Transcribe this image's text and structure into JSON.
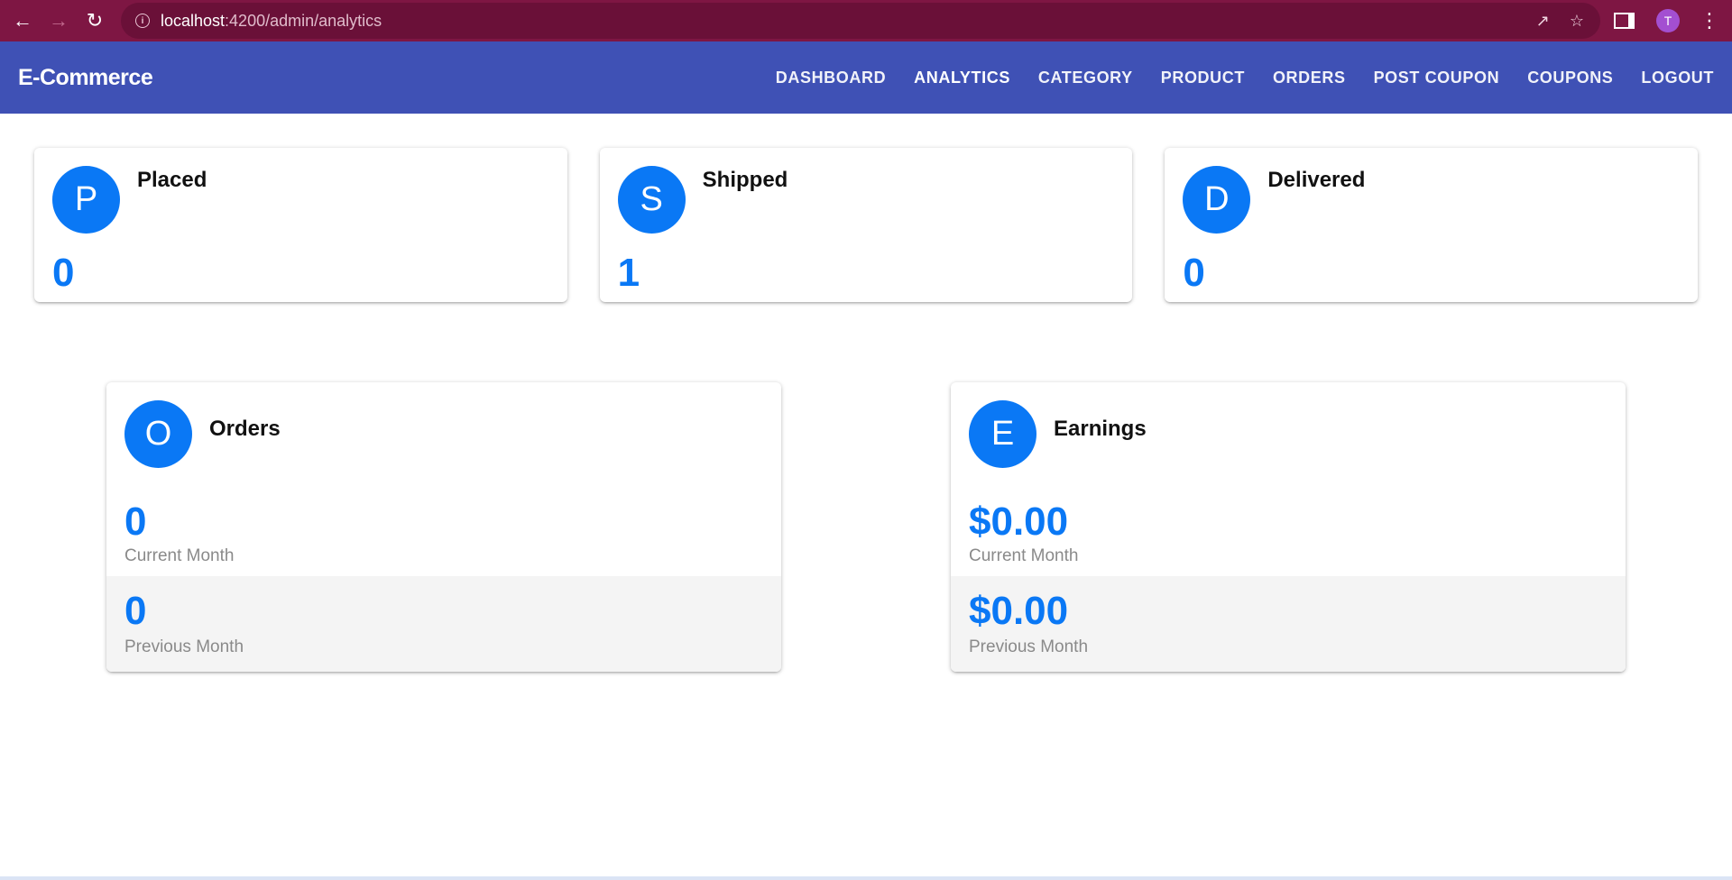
{
  "browser": {
    "url_host": "localhost",
    "url_path": ":4200/admin/analytics",
    "profile_initial": "T"
  },
  "toolbar": {
    "brand": "E-Commerce",
    "nav": [
      "DASHBOARD",
      "ANALYTICS",
      "CATEGORY",
      "PRODUCT",
      "ORDERS",
      "POST COUPON",
      "COUPONS",
      "LOGOUT"
    ],
    "active": "ANALYTICS"
  },
  "status_cards": [
    {
      "initial": "P",
      "title": "Placed",
      "count": "0"
    },
    {
      "initial": "S",
      "title": "Shipped",
      "count": "1"
    },
    {
      "initial": "D",
      "title": "Delivered",
      "count": "0"
    }
  ],
  "summary_cards": [
    {
      "initial": "O",
      "title": "Orders",
      "current_value": "0",
      "current_label": "Current Month",
      "previous_value": "0",
      "previous_label": "Previous Month"
    },
    {
      "initial": "E",
      "title": "Earnings",
      "current_value": "$0.00",
      "current_label": "Current Month",
      "previous_value": "$0.00",
      "previous_label": "Previous Month"
    }
  ],
  "colors": {
    "browser_bar": "#7e1643",
    "toolbar": "#3f51b5",
    "accent": "#0a78f5"
  }
}
